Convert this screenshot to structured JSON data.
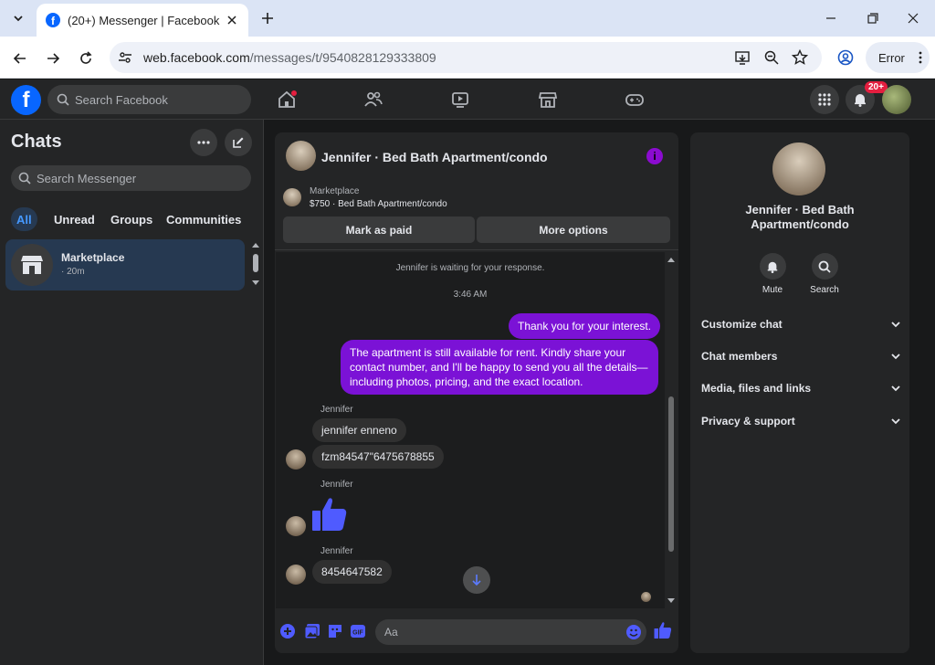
{
  "browser": {
    "tab_title": "(20+) Messenger | Facebook",
    "url_host": "web.facebook.com",
    "url_path": "/messages/t/9540828129333809",
    "error_label": "Error"
  },
  "fb": {
    "search_placeholder": "Search Facebook",
    "notification_badge": "20+"
  },
  "chats": {
    "title": "Chats",
    "search_placeholder": "Search Messenger",
    "filters": [
      "All",
      "Unread",
      "Groups",
      "Communities"
    ],
    "items": [
      {
        "name": "Marketplace",
        "time": "· 20m"
      }
    ]
  },
  "conversation": {
    "name": "Jennifer · Bed Bath Apartment/condo",
    "marketplace_label": "Marketplace",
    "listing": "$750 · Bed Bath Apartment/condo",
    "mark_paid": "Mark as paid",
    "more_options": "More options",
    "waiting": "Jennifer is waiting for your response.",
    "timestamp": "3:46 AM",
    "messages": {
      "out1": "Thank you for your interest.",
      "out2": "The apartment is still available for rent. Kindly share your contact number, and I'll be happy to send you all the details—including photos, pricing, and the exact location.",
      "sender": "Jennifer",
      "in1": "jennifer enneno",
      "in2": "fzm84547\"6475678855",
      "in3": "8454647582"
    },
    "composer_placeholder": "Aa"
  },
  "details": {
    "name": "Jennifer · Bed Bath Apartment/condo",
    "mute": "Mute",
    "search": "Search",
    "sections": [
      "Customize chat",
      "Chat members",
      "Media, files and links",
      "Privacy & support"
    ]
  },
  "colors": {
    "accent": "#7b12d6",
    "fb_blue": "#0866ff",
    "like_blue": "#4f5bff"
  }
}
